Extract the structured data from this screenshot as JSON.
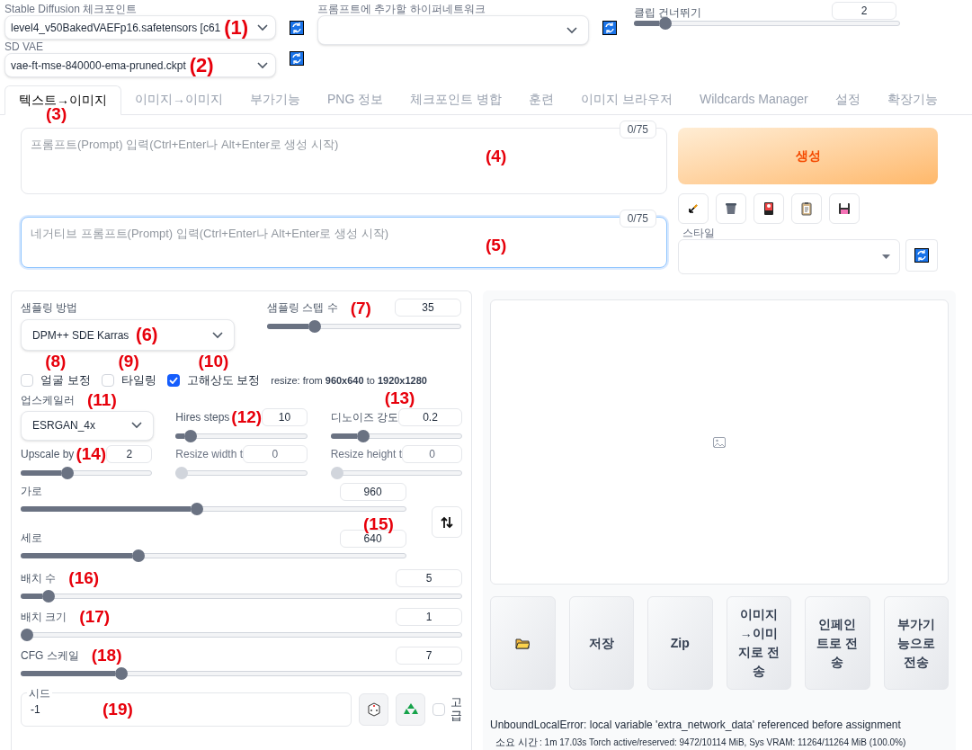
{
  "checkpoint": {
    "label": "Stable Diffusion 체크포인트",
    "value": "level4_v50BakedVAEFp16.safetensors [c61",
    "annotation": "(1)"
  },
  "vae": {
    "label": "SD VAE",
    "value": "vae-ft-mse-840000-ema-pruned.ckpt",
    "annotation": "(2)"
  },
  "hypernetwork": {
    "label": "프롬프트에 추가할 하이퍼네트워크"
  },
  "clip_skip": {
    "label": "클립 건너뛰기",
    "value": "2",
    "level": 0.1
  },
  "tabs": [
    {
      "label": "텍스트→이미지",
      "selected": true,
      "annotation": "(3)"
    },
    {
      "label": "이미지→이미지",
      "selected": false
    },
    {
      "label": "부가기능",
      "selected": false
    },
    {
      "label": "PNG 정보",
      "selected": false
    },
    {
      "label": "체크포인트 병합",
      "selected": false
    },
    {
      "label": "훈련",
      "selected": false
    },
    {
      "label": "이미지 브라우저",
      "selected": false
    },
    {
      "label": "Wildcards Manager",
      "selected": false
    },
    {
      "label": "설정",
      "selected": false
    },
    {
      "label": "확장기능",
      "selected": false
    }
  ],
  "prompts": [
    {
      "placeholder": "프롬프트(Prompt) 입력(Ctrl+Enter나 Alt+Enter로 생성 시작)",
      "counter": "0/75",
      "focused": false,
      "annotation": "(4)"
    },
    {
      "placeholder": "네거티브 프롬프트(Prompt) 입력(Ctrl+Enter나 Alt+Enter로 생성 시작)",
      "counter": "0/75",
      "focused": true,
      "annotation": "(5)"
    }
  ],
  "generate_button": "생성",
  "style": {
    "label": "스타일"
  },
  "sampler": {
    "label": "샘플링 방법",
    "value": "DPM++ SDE Karras",
    "annotation": "(6)"
  },
  "steps": {
    "label": "샘플링 스텝 수",
    "value": "35",
    "level": 0.23,
    "annotation": "(7)"
  },
  "checkboxes": [
    {
      "label": "얼굴 보정",
      "checked": false,
      "annotation": "(8)"
    },
    {
      "label": "타일링",
      "checked": false,
      "annotation": "(9)"
    },
    {
      "label": "고해상도 보정",
      "checked": true,
      "annotation": "(10)"
    }
  ],
  "resize_note": "resize: from **960x640** to **1920x1280**",
  "upscaler": {
    "label": "업스케일러",
    "value": "ESRGAN_4x",
    "annotation": "(11)"
  },
  "hires_sliders": [
    {
      "label": "Hires steps",
      "value": "10",
      "level": 0.07,
      "disabled": false,
      "annotation": "(12)"
    },
    {
      "label": "디노이즈 강도",
      "value": "0.2",
      "level": 0.22,
      "disabled": false,
      "annotation": "(13)"
    },
    {
      "label": "Upscale by",
      "value": "2",
      "level": 0.34,
      "disabled": false,
      "annotation": "(14)"
    },
    {
      "label": "Resize width t",
      "value": "0",
      "level": 0,
      "disabled": true
    },
    {
      "label": "Resize height t",
      "value": "0",
      "level": 0,
      "disabled": true
    }
  ],
  "size_sliders": [
    {
      "label": "가로",
      "value": "960",
      "level": 0.455,
      "annotation": "(15)"
    },
    {
      "label": "세로",
      "value": "640",
      "level": 0.3
    }
  ],
  "sliders": [
    {
      "label": "배치 수",
      "value": "5",
      "level": 0.05,
      "annotation": "(16)"
    },
    {
      "label": "배치 크기",
      "value": "1",
      "level": 0,
      "annotation": "(17)"
    },
    {
      "label": "CFG 스케일",
      "value": "7",
      "level": 0.22,
      "annotation": "(18)"
    }
  ],
  "seed": {
    "label": "시드",
    "value": "-1",
    "annotation": "(19)"
  },
  "advanced": {
    "label": "고급",
    "checked": false
  },
  "output_buttons": [
    {
      "kind": "folder"
    },
    {
      "kind": "text",
      "label": "저장"
    },
    {
      "kind": "text",
      "label": "Zip"
    },
    {
      "kind": "text",
      "label": "이미지→이미지로 전송"
    },
    {
      "kind": "text",
      "label": "인페인트로 전송"
    },
    {
      "kind": "text",
      "label": "부가기능으로 전송"
    }
  ],
  "error": "UnboundLocalError: local variable 'extra_network_data' referenced before assignment",
  "timing": {
    "label": "소요 시간",
    "text": ": 1m 17.03s  Torch active/reserved: 9472/10114 MiB, Sys VRAM: 11264/11264 MiB (100.0%)"
  }
}
